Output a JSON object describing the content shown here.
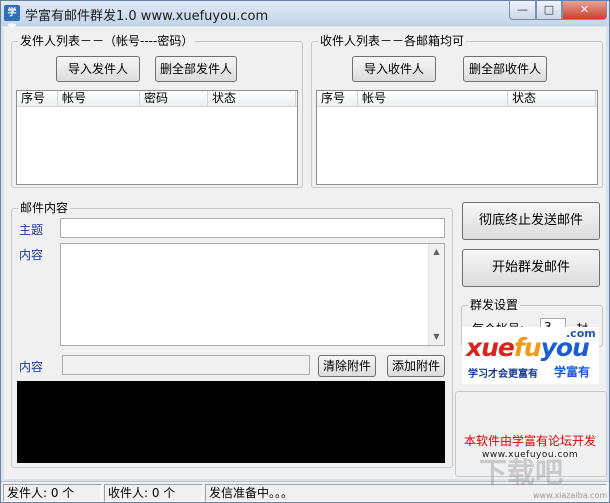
{
  "window": {
    "title": "学富有邮件群发1.0 www.xuefuyou.com",
    "icon_label": "学富",
    "minimize_glyph": "—",
    "maximize_glyph": "□",
    "close_glyph": "✕"
  },
  "sender": {
    "group_title": "发件人列表－－（帐号----密码）",
    "import_button": "导入发件人",
    "delete_all_button": "删全部发件人",
    "columns": [
      "序号",
      "帐号",
      "密码",
      "状态"
    ],
    "rows": []
  },
  "recipient": {
    "group_title": "收件人列表－－各邮箱均可",
    "import_button": "导入收件人",
    "delete_all_button": "删全部收件人",
    "columns": [
      "序号",
      "帐号",
      "状态"
    ],
    "rows": []
  },
  "mail": {
    "group_title": "邮件内容",
    "subject_label": "主题",
    "subject_value": "",
    "content_label": "内容",
    "content_value": "",
    "attachment_label": "内容",
    "attachment_value": "",
    "clear_attachment_button": "清除附件",
    "add_attachment_button": "添加附件"
  },
  "actions": {
    "stop_button": "彻底终止发送邮件",
    "start_button": "开始群发邮件"
  },
  "settings": {
    "group_title": "群发设置",
    "per_account_label": "每个帐号:",
    "per_account_value": "3",
    "unit": "封"
  },
  "logo": {
    "text_xue": "xue",
    "text_fu": "fu",
    "text_you": "you",
    "dotcom": ".com",
    "slogan": "学习才会更富有",
    "name": "学富有"
  },
  "credit": {
    "text": "本软件由学富有论坛开发",
    "url": "www.xuefuyou.com"
  },
  "status": {
    "sender_count": "发件人: 0 个",
    "recipient_count": "收件人: 0 个",
    "message": "发信准备中。。。"
  },
  "watermark": {
    "main": "下载吧",
    "sub": "www.xiazaiba.com"
  },
  "colors": {
    "logo_red": "#d9231c",
    "logo_orange": "#f39a1b",
    "logo_blue": "#1b5dd2",
    "credit_red": "#e00000"
  }
}
